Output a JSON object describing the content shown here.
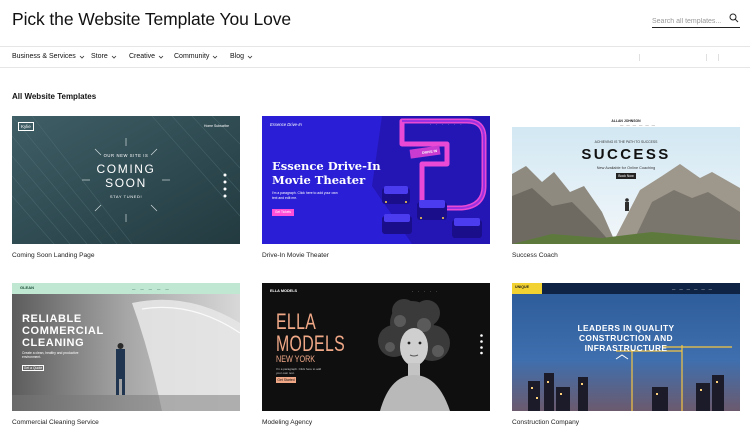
{
  "header": {
    "title": "Pick the Website Template You Love",
    "search_placeholder": "Search all templates..."
  },
  "nav": {
    "items": [
      {
        "label": "Business & Services"
      },
      {
        "label": "Store"
      },
      {
        "label": "Creative"
      },
      {
        "label": "Community"
      },
      {
        "label": "Blog"
      }
    ]
  },
  "section": {
    "title": "All Website Templates"
  },
  "templates": [
    {
      "name": "Coming Soon Landing Page",
      "logo": "Kylie",
      "nav": "Home   Subscribe",
      "pre": "OUR NEW SITE IS",
      "headline1": "COMING",
      "headline2": "SOON",
      "sub": "STAY TUNED!"
    },
    {
      "name": "Drive-In Movie Theater",
      "logo": "Essence Drive-In",
      "headline1": "Essence Drive-In",
      "headline2": "Movie Theater",
      "body": "I'm a paragraph. Click here to add your own text and edit me.",
      "button": "Get Tickets",
      "sign": "DRIVE IN"
    },
    {
      "name": "Success Coach",
      "logo": "ALLAN JOHNSON",
      "pre": "ACHIEVING IS THE PATH TO SUCCESS",
      "headline": "SUCCESS",
      "sub": "New Available for Online Coaching",
      "button": "Book Now"
    },
    {
      "name": "Commercial Cleaning Service",
      "logo": "GLEAN",
      "headline1": "RELIABLE",
      "headline2": "COMMERCIAL",
      "headline3": "CLEANING",
      "body": "Create a clean, healthy and productive environment.",
      "button": "Get a Quote"
    },
    {
      "name": "Modeling Agency",
      "logo": "ELLA MODELS",
      "headline1": "ELLA",
      "headline2": "MODELS",
      "sub": "NEW YORK",
      "body": "I'm a paragraph. Click here to add your own text.",
      "button": "Get Started"
    },
    {
      "name": "Construction Company",
      "logo": "UNIQUE",
      "headline1": "LEADERS IN QUALITY",
      "headline2": "CONSTRUCTION AND",
      "headline3": "INFRASTRUCTURE"
    }
  ],
  "colors": {
    "drivein_bg": "#2a1fd6",
    "drivein_accent": "#ff4fd8",
    "cleaning_bar": "#bfe7d2",
    "construction_bar": "#f2d233"
  }
}
